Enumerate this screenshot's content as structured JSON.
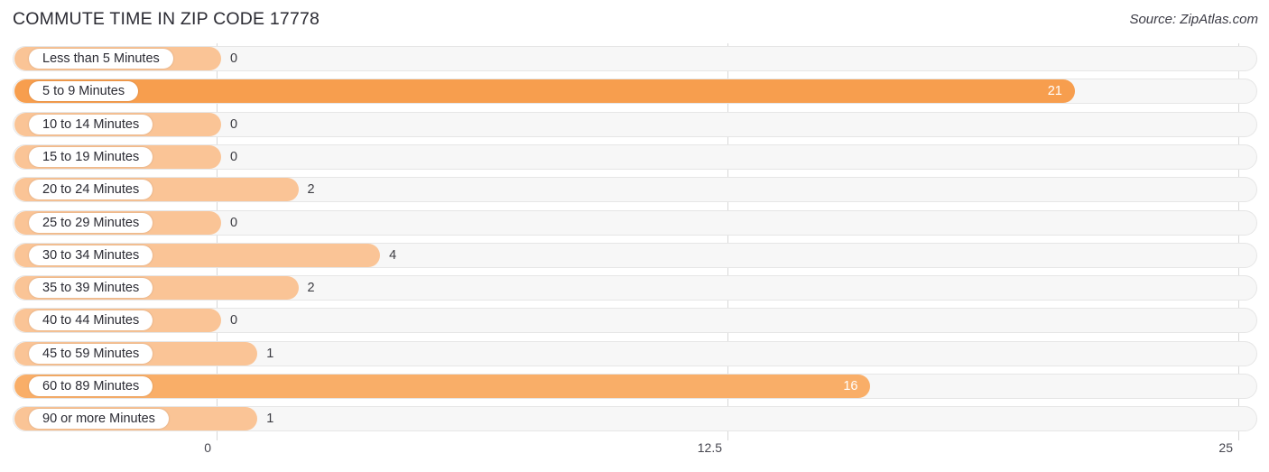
{
  "header": {
    "title": "COMMUTE TIME IN ZIP CODE 17778",
    "source": "Source: ZipAtlas.com"
  },
  "colors": {
    "bar_light": "#fac496",
    "bar_medium": "#f9ae68",
    "bar_dark": "#f79e4e",
    "track": "#f7f7f7",
    "gridline": "#d8d8d8",
    "text": "#2b2b33"
  },
  "chart_data": {
    "type": "bar",
    "orientation": "horizontal",
    "title": "COMMUTE TIME IN ZIP CODE 17778",
    "xlabel": "",
    "ylabel": "",
    "xlim": [
      0,
      25
    ],
    "grid": true,
    "legend": "none",
    "source": "Source: ZipAtlas.com",
    "axis_ticks": [
      "0",
      "12.5",
      "25"
    ],
    "axis_tick_values": [
      0,
      12.5,
      25
    ],
    "categories": [
      "Less than 5 Minutes",
      "5 to 9 Minutes",
      "10 to 14 Minutes",
      "15 to 19 Minutes",
      "20 to 24 Minutes",
      "25 to 29 Minutes",
      "30 to 34 Minutes",
      "35 to 39 Minutes",
      "40 to 44 Minutes",
      "45 to 59 Minutes",
      "60 to 89 Minutes",
      "90 or more Minutes"
    ],
    "values": [
      0,
      21,
      0,
      0,
      2,
      0,
      4,
      2,
      0,
      1,
      16,
      1
    ],
    "value_labels": [
      "0",
      "21",
      "0",
      "0",
      "2",
      "0",
      "4",
      "2",
      "0",
      "1",
      "16",
      "1"
    ]
  },
  "rows": [
    {
      "label": "Less than 5 Minutes",
      "value": 0,
      "value_label": "0",
      "shade": "light",
      "inside": false
    },
    {
      "label": "5 to 9 Minutes",
      "value": 21,
      "value_label": "21",
      "shade": "dark",
      "inside": true
    },
    {
      "label": "10 to 14 Minutes",
      "value": 0,
      "value_label": "0",
      "shade": "light",
      "inside": false
    },
    {
      "label": "15 to 19 Minutes",
      "value": 0,
      "value_label": "0",
      "shade": "light",
      "inside": false
    },
    {
      "label": "20 to 24 Minutes",
      "value": 2,
      "value_label": "2",
      "shade": "light",
      "inside": false
    },
    {
      "label": "25 to 29 Minutes",
      "value": 0,
      "value_label": "0",
      "shade": "light",
      "inside": false
    },
    {
      "label": "30 to 34 Minutes",
      "value": 4,
      "value_label": "4",
      "shade": "light",
      "inside": false
    },
    {
      "label": "35 to 39 Minutes",
      "value": 2,
      "value_label": "2",
      "shade": "light",
      "inside": false
    },
    {
      "label": "40 to 44 Minutes",
      "value": 0,
      "value_label": "0",
      "shade": "light",
      "inside": false
    },
    {
      "label": "45 to 59 Minutes",
      "value": 1,
      "value_label": "1",
      "shade": "light",
      "inside": false
    },
    {
      "label": "60 to 89 Minutes",
      "value": 16,
      "value_label": "16",
      "shade": "medium",
      "inside": true
    },
    {
      "label": "90 or more Minutes",
      "value": 1,
      "value_label": "1",
      "shade": "light",
      "inside": false
    }
  ]
}
